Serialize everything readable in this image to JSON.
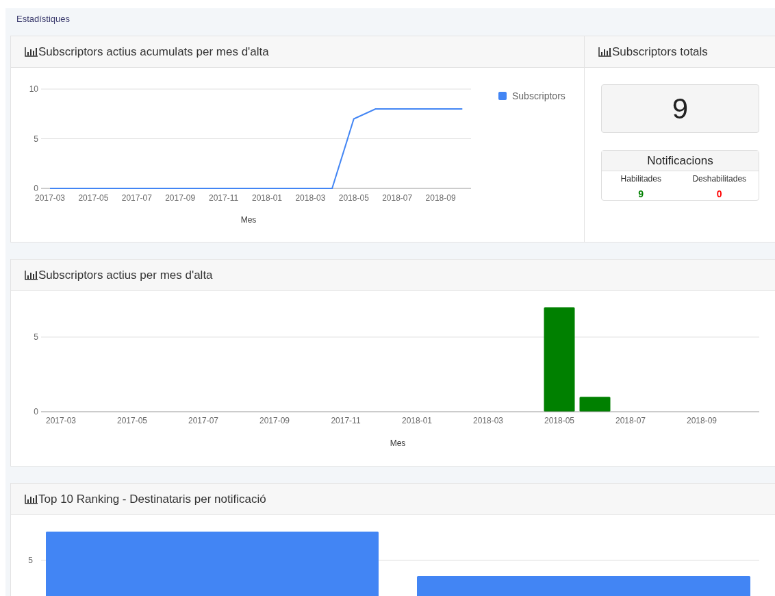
{
  "page": {
    "title": "Estadístiques"
  },
  "cumulative_card": {
    "title": "Subscriptors actius acumulats per mes d'alta",
    "chart_data": {
      "type": "line",
      "xlabel": "Mes",
      "categories": [
        "2017-03",
        null,
        "2017-05",
        null,
        "2017-07",
        null,
        "2017-09",
        null,
        "2017-11",
        null,
        "2018-01",
        null,
        "2018-03",
        null,
        "2018-05",
        null,
        "2018-07",
        null,
        "2018-09",
        null
      ],
      "series": [
        {
          "name": "Subscriptors",
          "color": "#4285f4",
          "values": [
            0,
            0,
            0,
            0,
            0,
            0,
            0,
            0,
            0,
            0,
            0,
            0,
            0,
            0,
            7,
            8,
            8,
            8,
            8,
            8
          ]
        }
      ],
      "ylim": [
        0,
        10
      ],
      "yticks": [
        0,
        5,
        10
      ]
    }
  },
  "totals_card": {
    "title": "Subscriptors totals",
    "total": "9",
    "notifications": {
      "title": "Notificacions",
      "columns": [
        {
          "label": "Habilitades",
          "value": "9",
          "color": "#008000"
        },
        {
          "label": "Deshabilitades",
          "value": "0",
          "color": "#ff0000"
        }
      ]
    }
  },
  "monthly_card": {
    "title": "Subscriptors actius per mes d'alta",
    "chart_data": {
      "type": "bar",
      "xlabel": "Mes",
      "categories": [
        "2017-03",
        null,
        "2017-05",
        null,
        "2017-07",
        null,
        "2017-09",
        null,
        "2017-11",
        null,
        "2018-01",
        null,
        "2018-03",
        null,
        "2018-05",
        null,
        "2018-07",
        null,
        "2018-09",
        null
      ],
      "series": [
        {
          "color": "#008000",
          "values": [
            0,
            0,
            0,
            0,
            0,
            0,
            0,
            0,
            0,
            0,
            0,
            0,
            0,
            0,
            7,
            1,
            0,
            0,
            0,
            0
          ]
        }
      ],
      "ylim": [
        0,
        7
      ],
      "yticks": [
        0,
        5
      ]
    }
  },
  "ranking_card": {
    "title": "Top 10 Ranking - Destinataris per notificació",
    "ytick_label": "5"
  }
}
